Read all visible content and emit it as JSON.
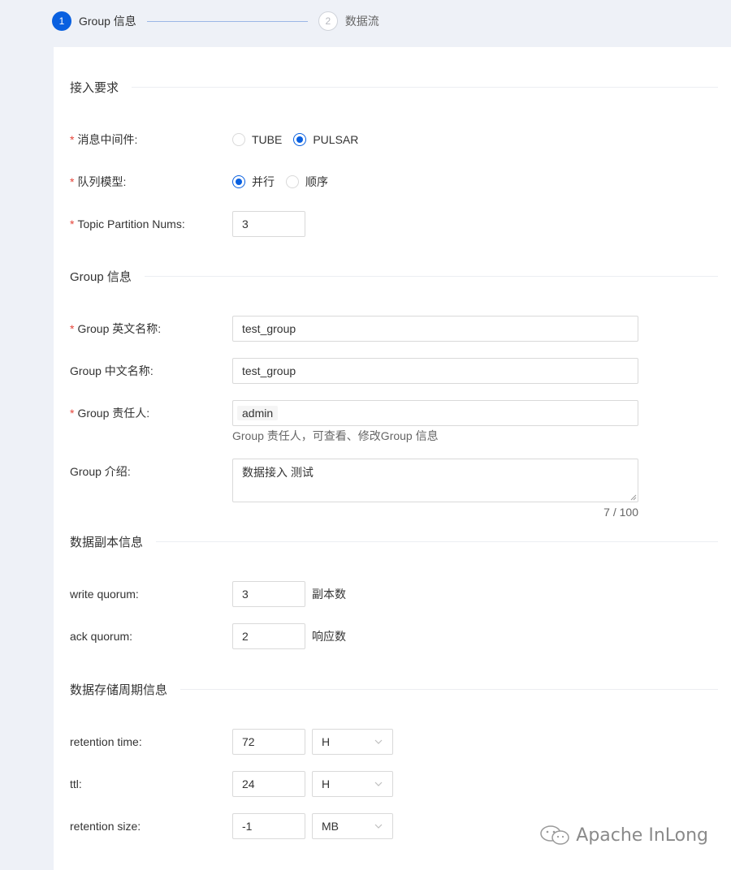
{
  "steps": [
    {
      "num": "1",
      "title": "Group 信息"
    },
    {
      "num": "2",
      "title": "数据流"
    }
  ],
  "sections": {
    "access": "接入要求",
    "group": "Group 信息",
    "replica": "数据副本信息",
    "storage": "数据存储周期信息"
  },
  "fields": {
    "middleware": {
      "required": "*",
      "label": "消息中间件",
      "colon": ":",
      "options": [
        "TUBE",
        "PULSAR"
      ],
      "selected": "PULSAR"
    },
    "queue_model": {
      "required": "*",
      "label": "队列模型",
      "colon": ":",
      "options": [
        "并行",
        "顺序"
      ],
      "selected": "并行"
    },
    "partition_nums": {
      "required": "*",
      "label": "Topic Partition Nums",
      "colon": ":",
      "value": "3"
    },
    "group_en_name": {
      "required": "*",
      "label": "Group 英文名称",
      "colon": ":",
      "value": "test_group"
    },
    "group_cn_name": {
      "label": "Group 中文名称",
      "colon": ":",
      "value": "test_group"
    },
    "group_owner": {
      "required": "*",
      "label": "Group 责任人",
      "colon": ":",
      "tag": "admin",
      "helper": "Group 责任人，可查看、修改Group 信息"
    },
    "group_desc": {
      "label": "Group 介绍",
      "colon": ":",
      "value": "数据接入 测试",
      "counter": "7 / 100"
    },
    "write_quorum": {
      "label": "write quorum",
      "colon": ":",
      "value": "3",
      "suffix": "副本数"
    },
    "ack_quorum": {
      "label": "ack quorum",
      "colon": ":",
      "value": "2",
      "suffix": "响应数"
    },
    "retention_time": {
      "label": "retention time",
      "colon": ":",
      "value": "72",
      "unit": "H"
    },
    "ttl": {
      "label": "ttl",
      "colon": ":",
      "value": "24",
      "unit": "H"
    },
    "retention_size": {
      "label": "retention size",
      "colon": ":",
      "value": "-1",
      "unit": "MB"
    }
  },
  "watermark": "Apache InLong",
  "colors": {
    "primary": "#0960e0",
    "required": "#e5453a",
    "background": "#eef1f7"
  }
}
